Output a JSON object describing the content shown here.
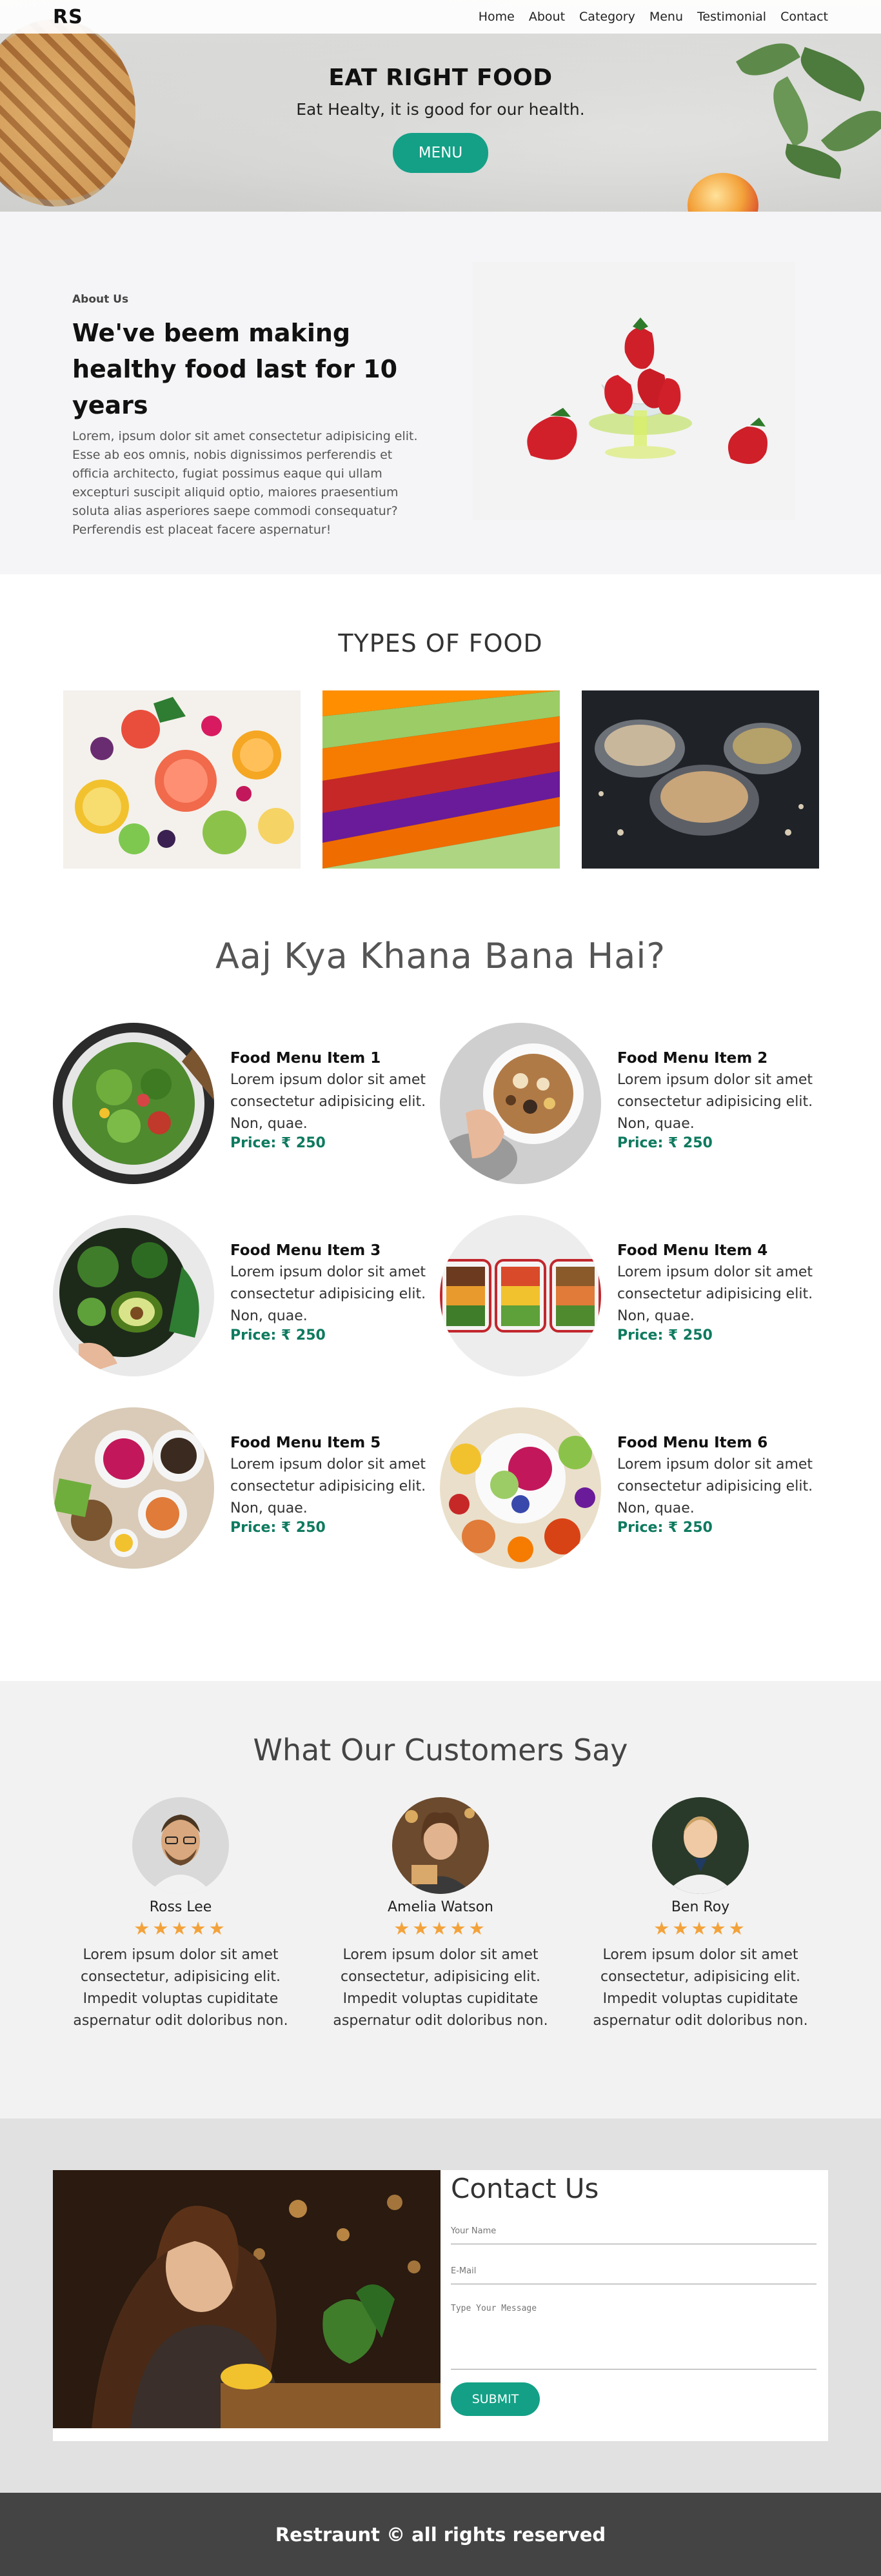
{
  "nav": {
    "logo": "RS",
    "links": [
      "Home",
      "About",
      "Category",
      "Menu",
      "Testimonial",
      "Contact"
    ]
  },
  "hero": {
    "title": "EAT RIGHT FOOD",
    "subtitle": "Eat Healty, it is good for our health.",
    "button": "MENU"
  },
  "about": {
    "tag": "About Us",
    "title": "We've beem making healthy food last for 10 years",
    "body": "Lorem, ipsum dolor sit amet consectetur adipisicing elit. Esse ab eos omnis, nobis dignissimos perferendis et officia architecto, fugiat possimus eaque qui ullam excepturi suscipit aliquid optio, maiores praesentium soluta alias asperiores saepe commodi consequatur? Perferendis est placeat facere aspernatur!"
  },
  "types": {
    "heading": "TYPES OF FOOD"
  },
  "menu": {
    "heading": "Aaj Kya Khana Bana Hai?",
    "items": [
      {
        "name": "Food Menu Item 1",
        "desc": "Lorem ipsum dolor sit amet consectetur adipisicing elit. Non, quae.",
        "price": "Price: ₹ 250"
      },
      {
        "name": "Food Menu Item 2",
        "desc": "Lorem ipsum dolor sit amet consectetur adipisicing elit. Non, quae.",
        "price": "Price: ₹ 250"
      },
      {
        "name": "Food Menu Item 3",
        "desc": "Lorem ipsum dolor sit amet consectetur adipisicing elit. Non, quae.",
        "price": "Price: ₹ 250"
      },
      {
        "name": "Food Menu Item 4",
        "desc": "Lorem ipsum dolor sit amet consectetur adipisicing elit. Non, quae.",
        "price": "Price: ₹ 250"
      },
      {
        "name": "Food Menu Item 5",
        "desc": "Lorem ipsum dolor sit amet consectetur adipisicing elit. Non, quae.",
        "price": "Price: ₹ 250"
      },
      {
        "name": "Food Menu Item 6",
        "desc": "Lorem ipsum dolor sit amet consectetur adipisicing elit. Non, quae.",
        "price": "Price: ₹ 250"
      }
    ]
  },
  "testimonials": {
    "heading": "What Our Customers Say",
    "stars": "★★★★★",
    "items": [
      {
        "name": "Ross Lee",
        "text": "Lorem ipsum dolor sit amet consectetur, adipisicing elit. Impedit voluptas cupiditate aspernatur odit doloribus non."
      },
      {
        "name": "Amelia Watson",
        "text": "Lorem ipsum dolor sit amet consectetur, adipisicing elit. Impedit voluptas cupiditate aspernatur odit doloribus non."
      },
      {
        "name": "Ben Roy",
        "text": "Lorem ipsum dolor sit amet consectetur, adipisicing elit. Impedit voluptas cupiditate aspernatur odit doloribus non."
      }
    ]
  },
  "contact": {
    "heading": "Contact Us",
    "name_placeholder": "Your Name",
    "email_placeholder": "E-Mail",
    "message_placeholder": "Type Your Message",
    "submit": "SUBMIT"
  },
  "footer": {
    "text": "Restraunt © all rights reserved"
  },
  "colors": {
    "accent": "#13a086",
    "price": "#0e7a5f",
    "stars": "#f3a23a",
    "footer_bg": "#444444"
  }
}
